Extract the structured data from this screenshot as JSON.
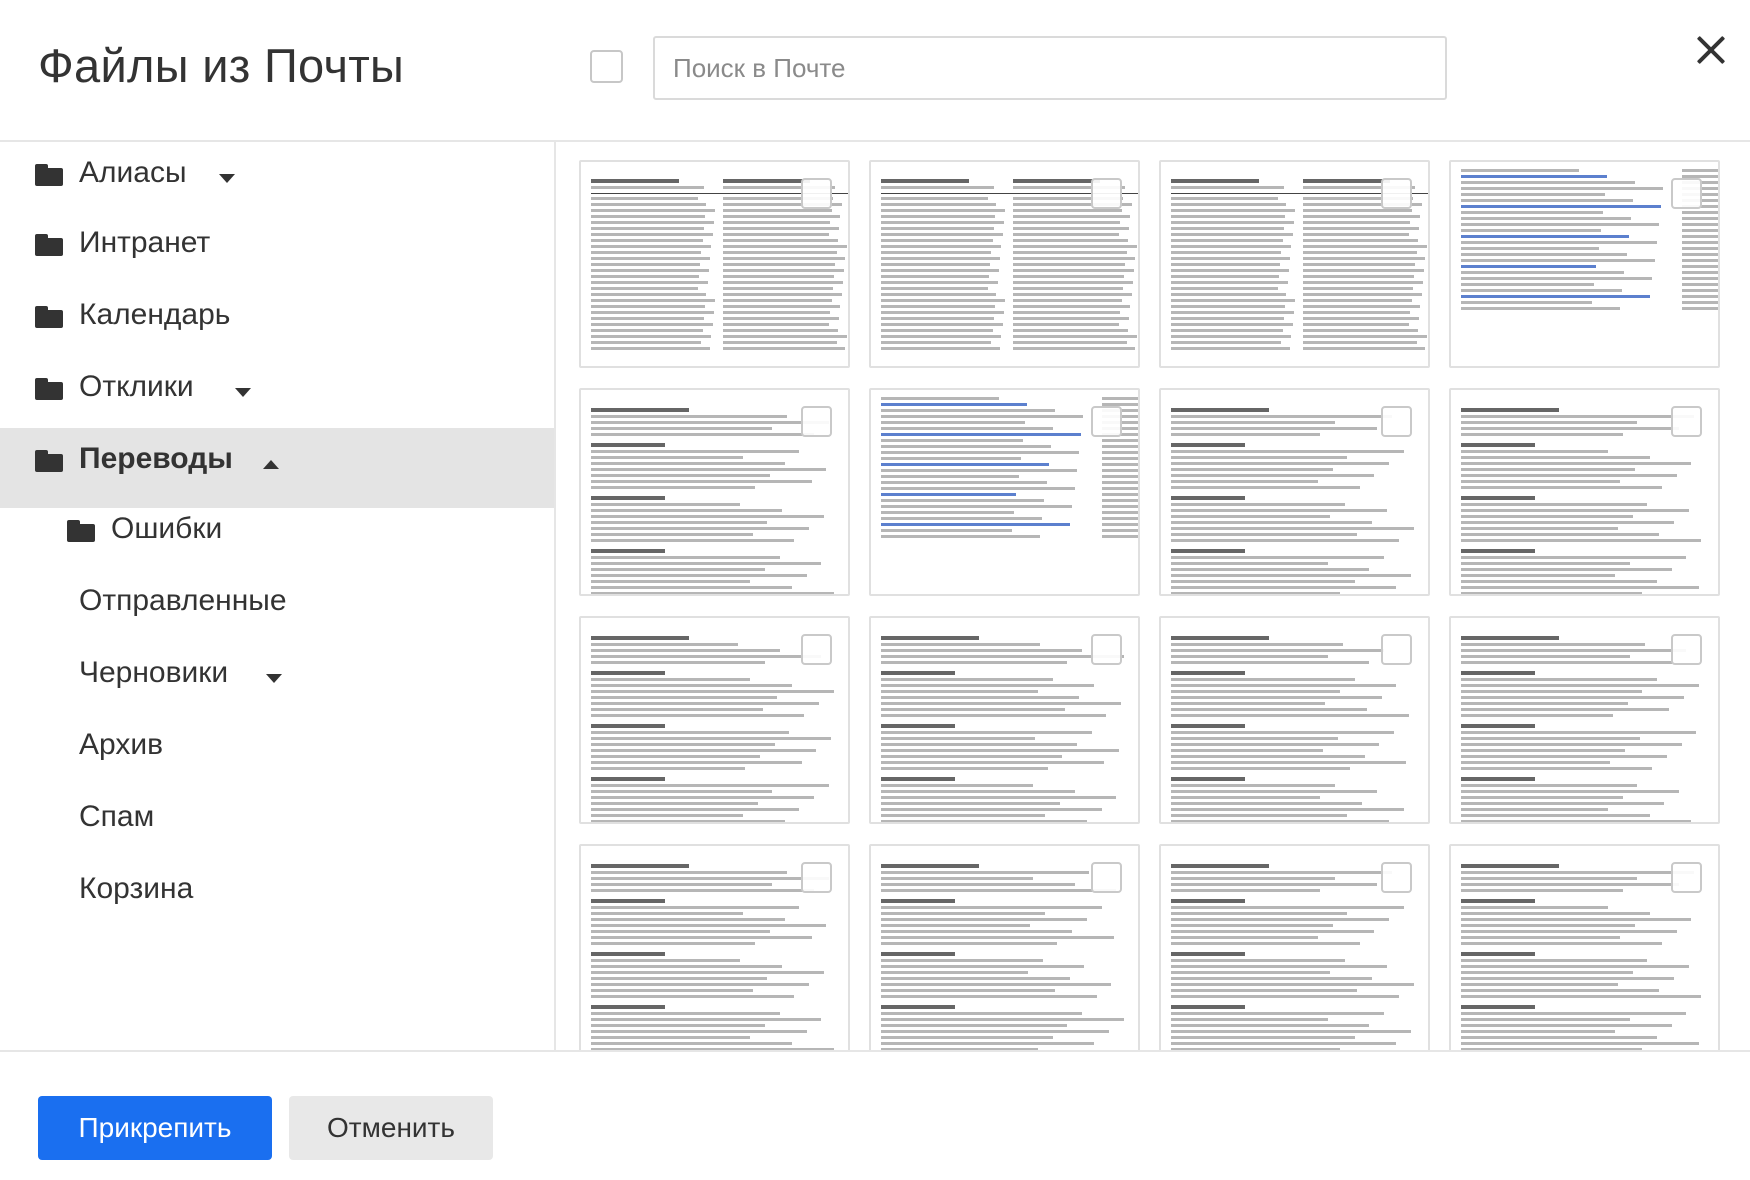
{
  "dialog": {
    "title": "Файлы из Почты",
    "search_placeholder": "Поиск в Почте"
  },
  "sidebar": {
    "folders": [
      {
        "label": "Алиасы",
        "has_caret": true,
        "caret": "down",
        "level": 0
      },
      {
        "label": "Интранет",
        "has_caret": false,
        "level": 0
      },
      {
        "label": "Календарь",
        "has_caret": false,
        "level": 0
      },
      {
        "label": "Отклики",
        "has_caret": true,
        "caret": "down",
        "level": 0
      },
      {
        "label": "Переводы",
        "has_caret": true,
        "caret": "up",
        "level": 0,
        "active": true
      },
      {
        "label": "Ошибки",
        "has_caret": false,
        "level": 1
      },
      {
        "label": "Отправленные",
        "has_caret": false,
        "level": 0,
        "no_icon": true
      },
      {
        "label": "Черновики",
        "has_caret": true,
        "caret": "down",
        "level": 0,
        "no_icon": true
      },
      {
        "label": "Архив",
        "has_caret": false,
        "level": 0,
        "no_icon": true
      },
      {
        "label": "Спам",
        "has_caret": false,
        "level": 0,
        "no_icon": true
      },
      {
        "label": "Корзина",
        "has_caret": false,
        "level": 0,
        "no_icon": true
      }
    ]
  },
  "files": {
    "rows": 4,
    "columns": 4,
    "selected_count": 0
  },
  "footer": {
    "attach_label": "Прикрепить",
    "cancel_label": "Отменить"
  },
  "colors": {
    "primary": "#1a6ff0",
    "active_folder_bg": "#e4e4e4",
    "secondary_button_bg": "#e8e8e8"
  }
}
